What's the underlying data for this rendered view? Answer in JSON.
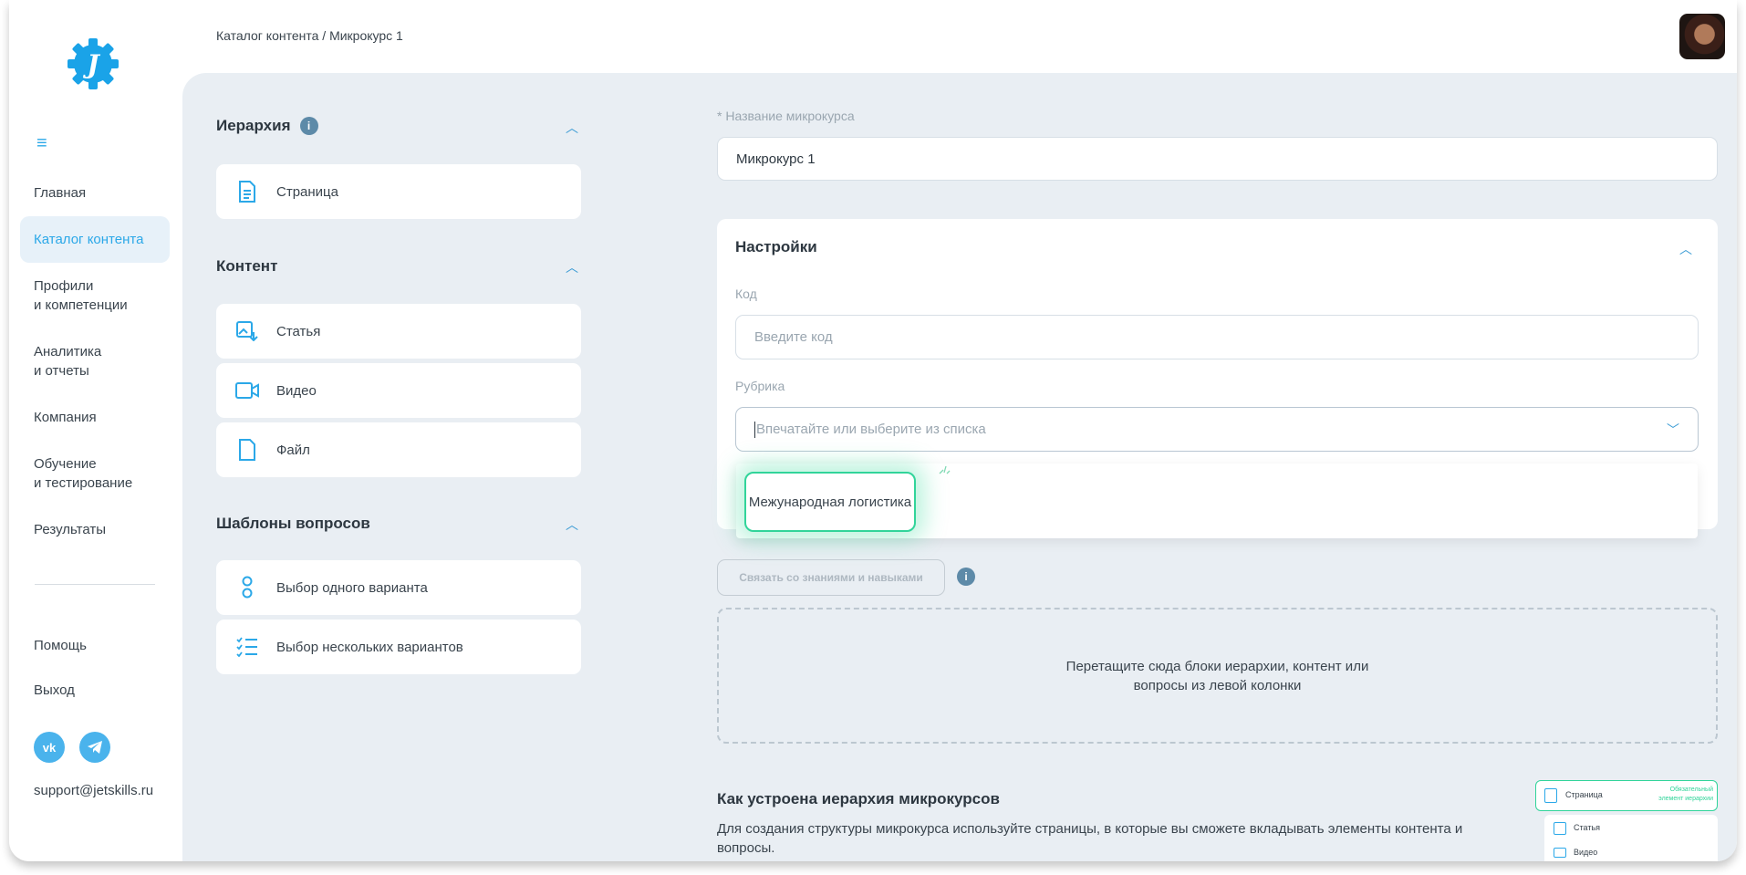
{
  "colors": {
    "accent": "#2ba8e8",
    "main_bg": "#e9eef3",
    "highlight": "#31d49a"
  },
  "sidebar": {
    "nav": [
      {
        "label": "Главная"
      },
      {
        "label": "Каталог контента",
        "active": true
      },
      {
        "label": "Профили\nи компетенции"
      },
      {
        "label": "Аналитика\nи отчеты"
      },
      {
        "label": "Компания"
      },
      {
        "label": "Обучение\nи тестирование"
      },
      {
        "label": "Результаты"
      }
    ],
    "help": "Помощь",
    "logout": "Выход",
    "social": {
      "vk": "vk",
      "telegram": "telegram"
    },
    "support_email": "support@jetskills.ru"
  },
  "header": {
    "breadcrumb": "Каталог контента / Микрокурс 1"
  },
  "left_panel": {
    "hierarchy": {
      "title": "Иерархия",
      "items": [
        {
          "label": "Страница",
          "icon": "page-icon"
        }
      ]
    },
    "content": {
      "title": "Контент",
      "items": [
        {
          "label": "Статья",
          "icon": "article-icon"
        },
        {
          "label": "Видео",
          "icon": "video-icon"
        },
        {
          "label": "Файл",
          "icon": "file-icon"
        }
      ]
    },
    "questions": {
      "title": "Шаблоны вопросов",
      "items": [
        {
          "label": "Выбор одного варианта",
          "icon": "single-choice-icon"
        },
        {
          "label": "Выбор нескольких вариантов",
          "icon": "multi-choice-icon"
        }
      ]
    }
  },
  "form": {
    "name_label": "* Название микрокурса",
    "name_value": "Микрокурс 1",
    "settings_title": "Настройки",
    "code_label": "Код",
    "code_placeholder": "Введите код",
    "rubric_label": "Рубрика",
    "rubric_placeholder": "Впечатайте или выберите из списка",
    "rubric_options": [
      "Межународная логистика"
    ],
    "link_button": "Связать со знаниями и навыками",
    "dropzone_line1": "Перетащите сюда блоки иерархии, контент или",
    "dropzone_line2": "вопросы из левой колонки"
  },
  "howto": {
    "title": "Как устроена иерархия микрокурсов",
    "text": "Для создания структуры микрокурса используйте страницы, в которые вы сможете вкладывать элементы контента и вопросы.",
    "mini_page": "Страница",
    "mini_required": "Обязательный элемент иерархии",
    "mini_article": "Статья",
    "mini_video": "Видео"
  }
}
